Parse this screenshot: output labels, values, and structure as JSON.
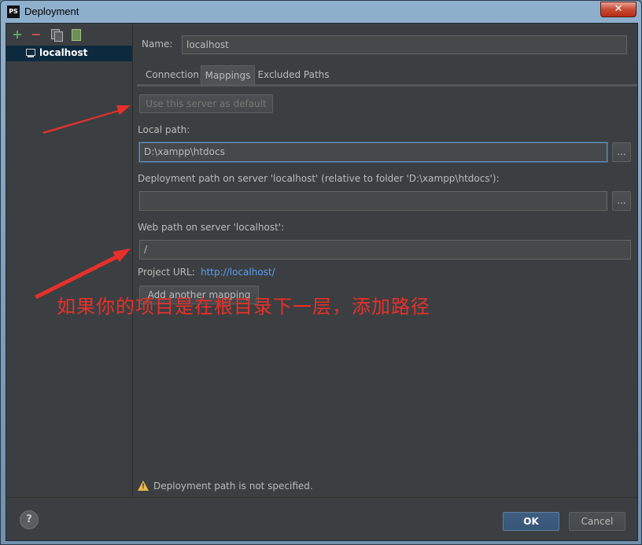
{
  "window": {
    "title": "Deployment",
    "app_icon_text": "PS",
    "close_label": "✕"
  },
  "sidebar": {
    "tools": [
      "add-icon",
      "remove-icon",
      "copy-icon",
      "set-default-icon"
    ],
    "add_glyph": "+",
    "remove_glyph": "−",
    "servers": [
      {
        "label": "localhost",
        "selected": true
      }
    ]
  },
  "main": {
    "name_label": "Name:",
    "name_value": "localhost",
    "tabs": [
      {
        "label": "Connection",
        "active": false
      },
      {
        "label": "Mappings",
        "active": true
      },
      {
        "label": "Excluded Paths",
        "active": false
      }
    ],
    "use_default_button": "Use this server as default",
    "local_path_label": "Local path:",
    "local_path_value": "D:\\xampp\\htdocs",
    "browse_label": "...",
    "deployment_path_label": "Deployment path on server 'localhost' (relative to folder 'D:\\xampp\\htdocs'):",
    "deployment_path_value": "",
    "web_path_label": "Web path on server 'localhost':",
    "web_path_value": "/",
    "project_url_label": "Project URL:",
    "project_url_value": "http://localhost/",
    "add_mapping_button": "Add another mapping",
    "warning_text": "Deployment path is not specified."
  },
  "footer": {
    "help_label": "?",
    "ok_label": "OK",
    "cancel_label": "Cancel"
  },
  "annotation": {
    "text": "如果你的项目是在根目录下一层，添加路径",
    "color": "#e8302a"
  },
  "colors": {
    "background": "#3c3f41",
    "selection": "#0d293e",
    "accent_link": "#589df6",
    "warning": "#e8b84a"
  }
}
